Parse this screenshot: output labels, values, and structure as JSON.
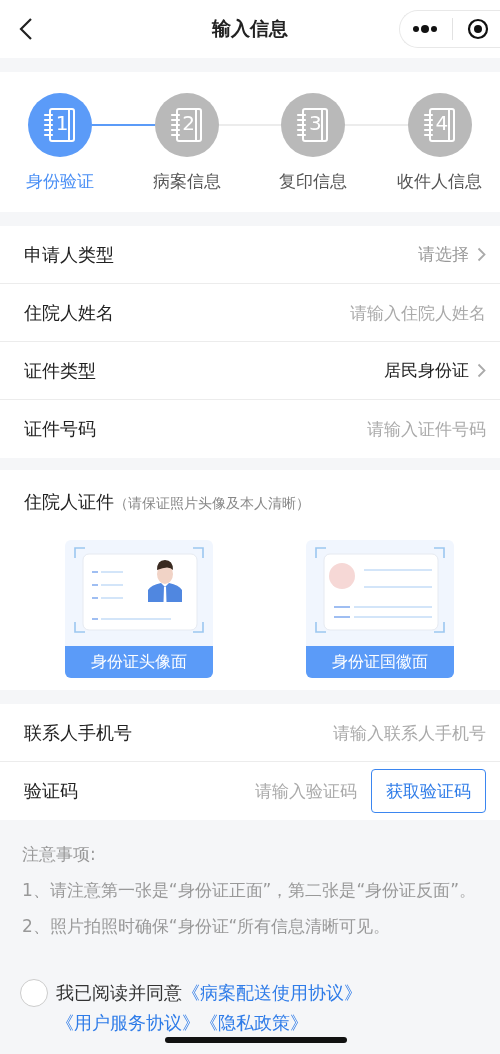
{
  "nav": {
    "title": "输入信息"
  },
  "steps": [
    {
      "number": "1",
      "label": "身份验证",
      "selected": true
    },
    {
      "number": "2",
      "label": "病案信息",
      "selected": false
    },
    {
      "number": "3",
      "label": "复印信息",
      "selected": false
    },
    {
      "number": "4",
      "label": "收件人信息",
      "selected": false
    }
  ],
  "form_rows": [
    {
      "kind": "select",
      "label": "申请人类型",
      "placeholder": "请选择"
    },
    {
      "kind": "input",
      "label": "住院人姓名",
      "placeholder": "请输入住院人姓名"
    },
    {
      "kind": "select",
      "label": "证件类型",
      "value": "居民身份证"
    },
    {
      "kind": "input",
      "label": "证件号码",
      "placeholder": "请输入证件号码"
    }
  ],
  "id_section": {
    "title": "住院人证件",
    "hint": "（请保证照片头像及本人清晰）",
    "uploads": [
      {
        "kind": "portrait",
        "label": "身份证头像面"
      },
      {
        "kind": "emblem",
        "label": "身份证国徽面"
      }
    ]
  },
  "contact_rows": [
    {
      "kind": "input",
      "label": "联系人手机号",
      "placeholder": "请输入联系人手机号"
    },
    {
      "kind": "code",
      "label": "验证码",
      "placeholder": "请输入验证码",
      "button": "获取验证码"
    }
  ],
  "notes": {
    "title": "注意事项:",
    "items": [
      "1、请注意第一张是“身份证正面”，第二张是“身份证反面”。",
      "2、照片拍照时确保“身份证“所有信息清晰可见。"
    ]
  },
  "agreement": {
    "checked": false,
    "text": "我已阅读并同意",
    "links": [
      "《病案配送使用协议》",
      "《用户服务协议》",
      "《隐私政策》"
    ]
  }
}
